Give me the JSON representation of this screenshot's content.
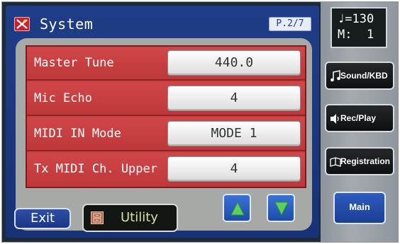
{
  "header": {
    "title": "System",
    "page_indicator": "P.2/7",
    "icon": "system-icon"
  },
  "parameters": [
    {
      "label": "Master Tune",
      "value": "440.0"
    },
    {
      "label": "Mic Echo",
      "value": "4"
    },
    {
      "label": "MIDI IN Mode",
      "value": "MODE 1"
    },
    {
      "label": "Tx MIDI Ch. Upper",
      "value": "4"
    }
  ],
  "footer": {
    "exit_label": "Exit",
    "utility_label": "Utility",
    "utility_icon": "utility-icon",
    "up_icon": "arrow-up-icon",
    "down_icon": "arrow-down-icon"
  },
  "side": {
    "tempo_value": "=130",
    "tempo_icon": "quarter-note-icon",
    "measure_label": "M:",
    "measure_value": "1",
    "buttons": [
      {
        "label": "Sound/KBD",
        "icon": "music-note-icon"
      },
      {
        "label": "Rec/Play",
        "icon": "speaker-icon"
      },
      {
        "label": "Registration",
        "icon": "book-icon"
      }
    ],
    "main_label": "Main"
  },
  "colors": {
    "panel_blue": "#1f3d86",
    "row_red": "#c8403f",
    "content_gray": "#a7a9a6",
    "arrow_green": "#5cd15e"
  }
}
